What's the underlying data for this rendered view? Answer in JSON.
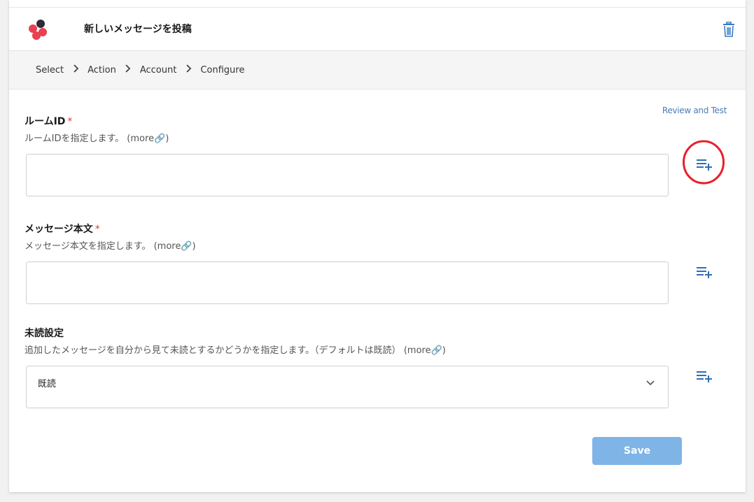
{
  "header": {
    "title": "新しいメッセージを投稿",
    "logo_icon": "chatwork-logo",
    "delete_icon": "trash-icon"
  },
  "breadcrumb": {
    "items": [
      "Select",
      "Action",
      "Account",
      "Configure"
    ],
    "separator": ">"
  },
  "review_link": "Review and Test",
  "fields": [
    {
      "label": "ルームID",
      "required_mark": "*",
      "description": "ルームIDを指定します。",
      "more": "(more🔗)",
      "value": ""
    },
    {
      "label": "メッセージ本文",
      "required_mark": "*",
      "description": "メッセージ本文を指定します。",
      "more": "(more🔗)",
      "value": ""
    },
    {
      "label": "未読設定",
      "description": "追加したメッセージを自分から見て未読とするかどうかを指定します。（デフォルトは既読）",
      "more": "(more🔗)",
      "value": "既読"
    }
  ],
  "save_label": "Save",
  "colors": {
    "accent": "#2f6eb5",
    "save_button": "#7fb4e6",
    "required": "#e03b3b",
    "annotation_circle": "#e8202a"
  }
}
